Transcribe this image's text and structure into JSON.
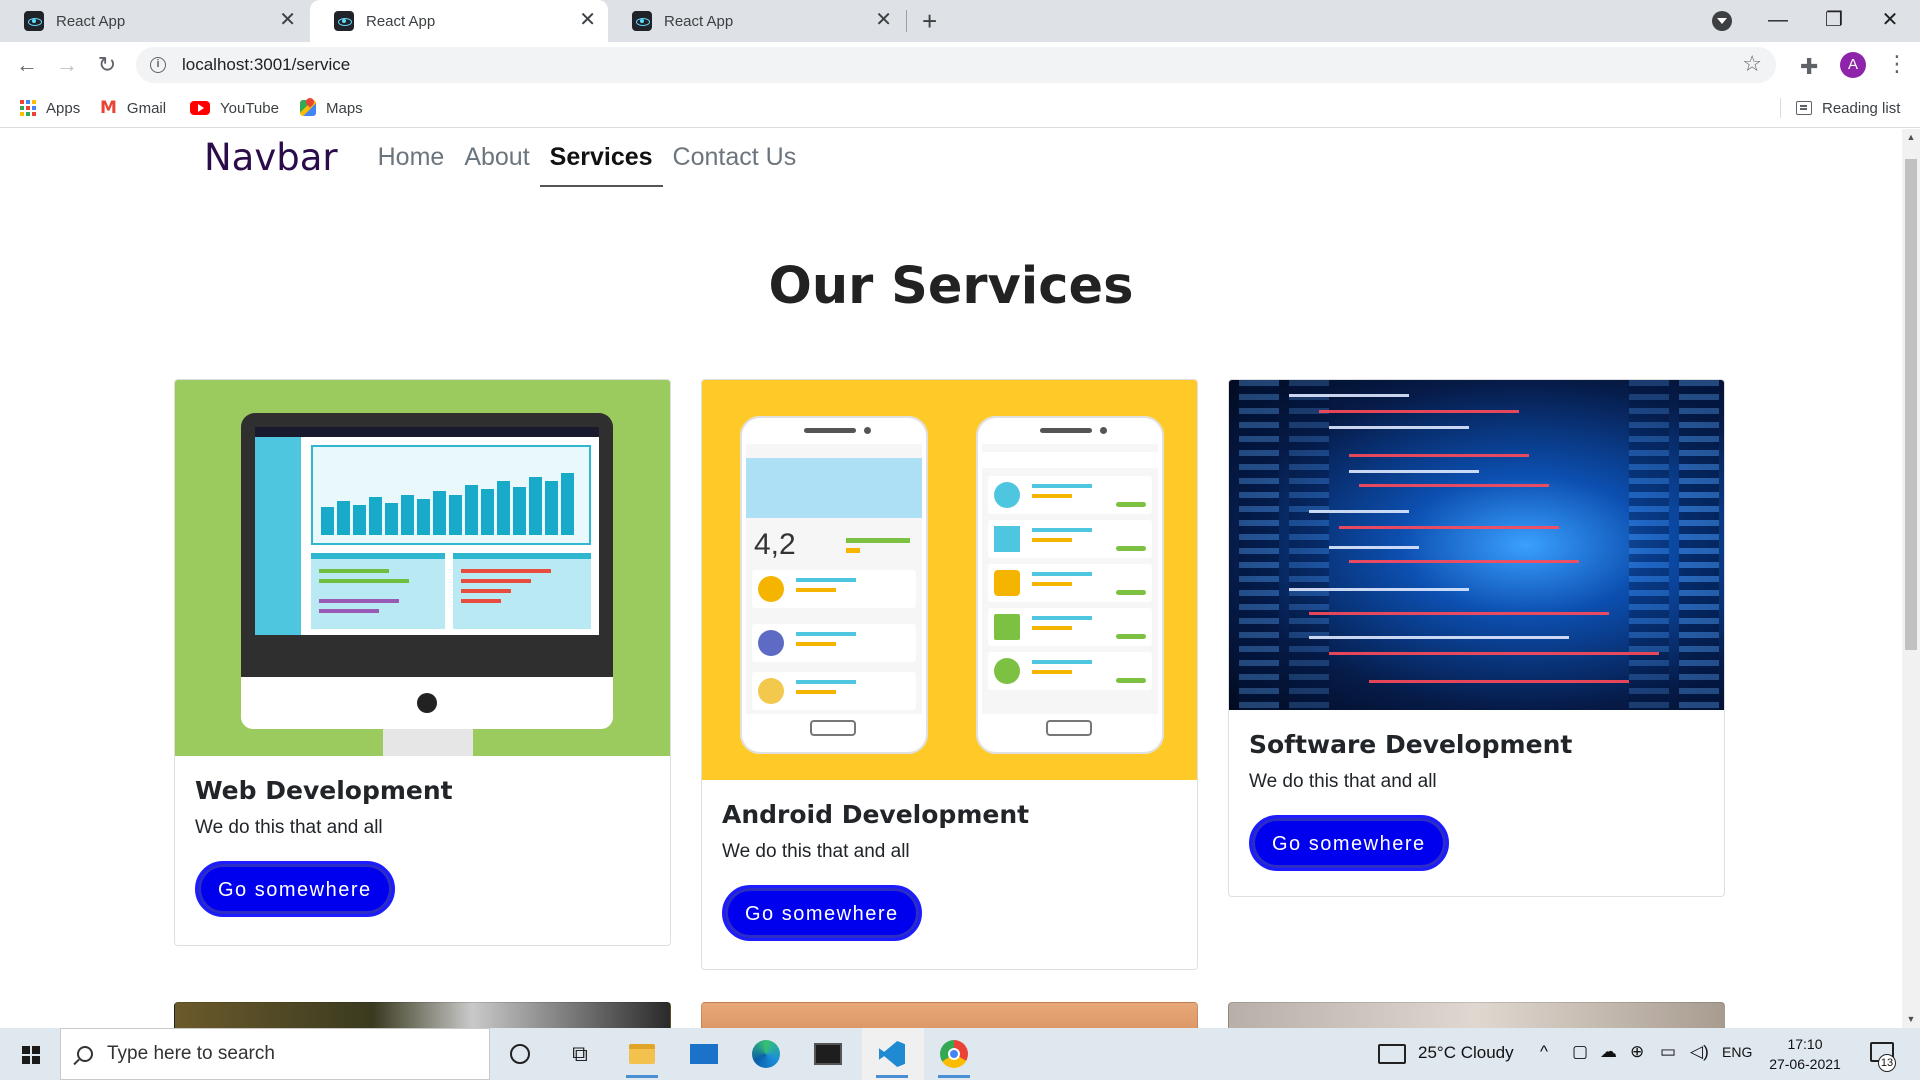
{
  "browser": {
    "tabs": [
      {
        "title": "React App",
        "active": false
      },
      {
        "title": "React App",
        "active": true
      },
      {
        "title": "React App",
        "active": false
      }
    ],
    "url": "localhost:3001/service",
    "profile_initial": "A",
    "bookmarks": [
      {
        "label": "Apps",
        "icon": "apps-grid-icon"
      },
      {
        "label": "Gmail",
        "icon": "gmail-icon"
      },
      {
        "label": "YouTube",
        "icon": "youtube-icon"
      },
      {
        "label": "Maps",
        "icon": "maps-icon"
      }
    ],
    "reading_list": "Reading list"
  },
  "navbar": {
    "brand": "Navbar",
    "links": [
      {
        "label": "Home",
        "active": false
      },
      {
        "label": "About",
        "active": false
      },
      {
        "label": "Services",
        "active": true
      },
      {
        "label": "Contact Us",
        "active": false
      }
    ]
  },
  "page": {
    "title": "Our Services",
    "cards": [
      {
        "title": "Web Development",
        "text": "We do this that and all",
        "button": "Go somewhere",
        "image": "web-development-illustration"
      },
      {
        "title": "Android Development",
        "text": "We do this that and all",
        "button": "Go somewhere",
        "image": "android-app-illustration"
      },
      {
        "title": "Software Development",
        "text": "We do this that and all",
        "button": "Go somewhere",
        "image": "code-server-room-photo"
      }
    ]
  },
  "taskbar": {
    "search_placeholder": "Type here to search",
    "weather": "25°C  Cloudy",
    "language": "ENG",
    "time": "17:10",
    "date": "27-06-2021",
    "notification_count": "13"
  },
  "colors": {
    "accent_button": "#0000ee",
    "brand_text": "#2b0c4b",
    "web_card_bg": "#9bcb5f",
    "android_card_bg": "#ffc928"
  }
}
